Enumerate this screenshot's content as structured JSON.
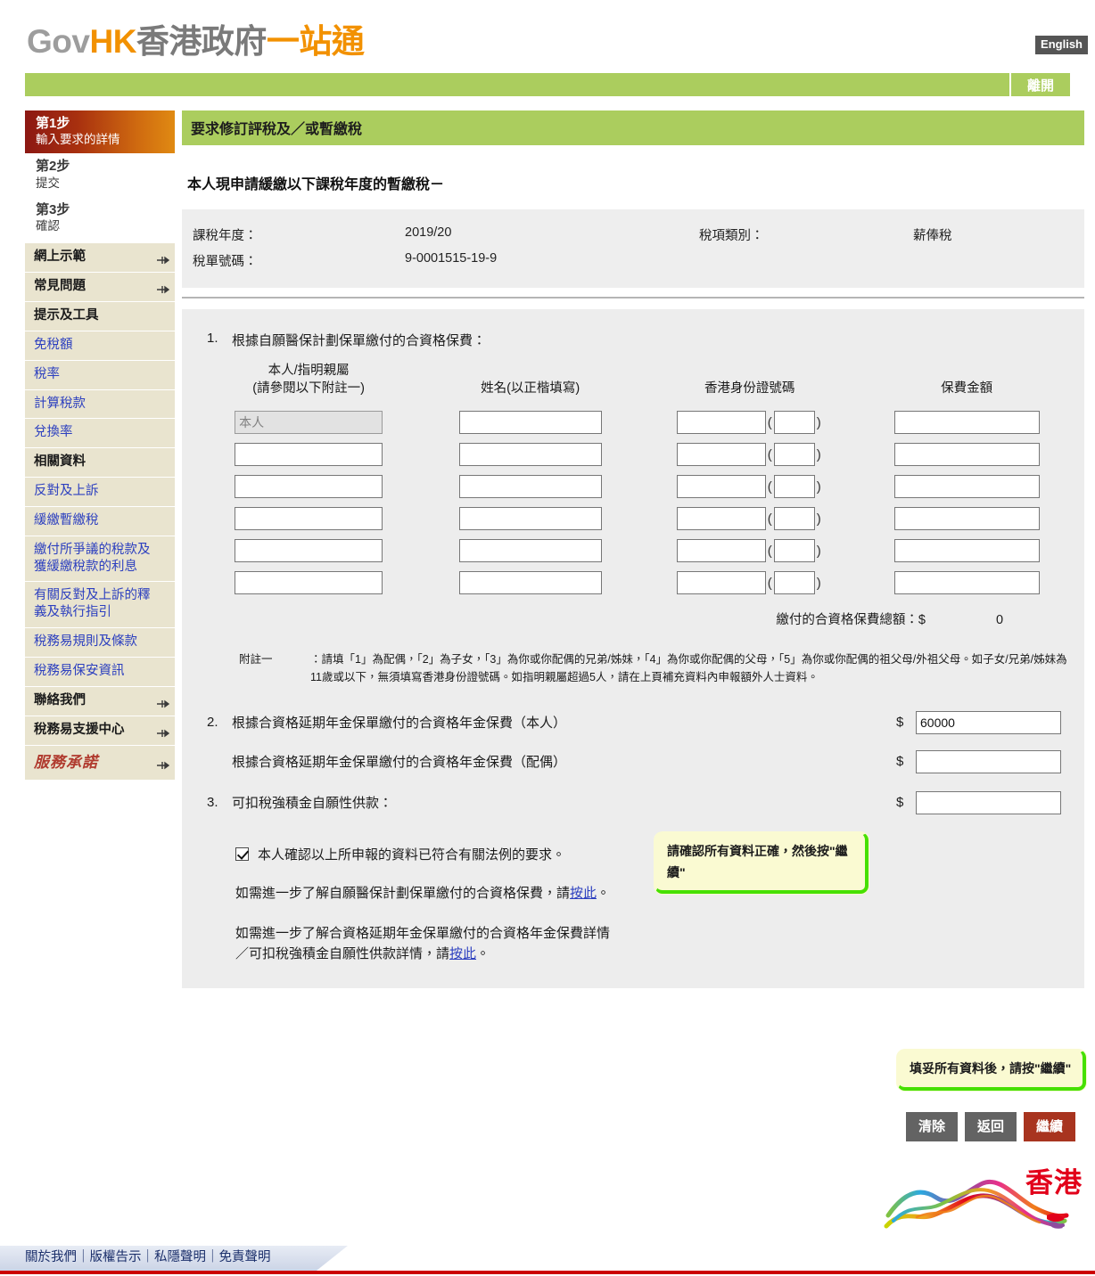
{
  "header": {
    "logo": {
      "gov": "Gov",
      "hk": "HK",
      "cn_gray": "香港政府",
      "cn_orange": "一站通"
    },
    "language_button": "English",
    "exit_button": "離開"
  },
  "sidebar": {
    "steps": [
      {
        "title": "第1步",
        "sub": "輸入要求的詳情",
        "active": true
      },
      {
        "title": "第2步",
        "sub": "提交",
        "active": false
      },
      {
        "title": "第3步",
        "sub": "確認",
        "active": false
      }
    ],
    "items": [
      {
        "label": "網上示範",
        "type": "head",
        "arrow": true
      },
      {
        "label": "常見問題",
        "type": "head",
        "arrow": true
      },
      {
        "label": "提示及工具",
        "type": "head",
        "arrow": false
      },
      {
        "label": "免稅額",
        "type": "link",
        "arrow": false
      },
      {
        "label": "稅率",
        "type": "link",
        "arrow": false
      },
      {
        "label": "計算稅款",
        "type": "link",
        "arrow": false
      },
      {
        "label": "兌換率",
        "type": "link",
        "arrow": false
      },
      {
        "label": "相關資料",
        "type": "head",
        "arrow": false
      },
      {
        "label": "反對及上訴",
        "type": "link",
        "arrow": false
      },
      {
        "label": "緩繳暫繳稅",
        "type": "link",
        "arrow": false
      },
      {
        "label": "繳付所爭議的稅款及獲緩繳稅款的利息",
        "type": "link",
        "arrow": false
      },
      {
        "label": "有關反對及上訴的釋義及執行指引",
        "type": "link",
        "arrow": false
      },
      {
        "label": "稅務易規則及條款",
        "type": "link",
        "arrow": false
      },
      {
        "label": "稅務易保安資訊",
        "type": "link",
        "arrow": false
      },
      {
        "label": "聯絡我們",
        "type": "head",
        "arrow": true
      },
      {
        "label": "稅務易支援中心",
        "type": "head",
        "arrow": true
      },
      {
        "label": "服務承諾",
        "type": "pledge",
        "arrow": true
      }
    ]
  },
  "main": {
    "page_title": "要求修訂評稅及／或暫繳稅",
    "section_heading": "本人現申請緩繳以下課稅年度的暫繳稅－",
    "info": {
      "year_label": "課稅年度：",
      "year_value": "2019/20",
      "type_label": "稅項類別：",
      "type_value": "薪俸稅",
      "bill_label": "稅單號碼：",
      "bill_value": "9-0001515-19-9"
    },
    "q1": {
      "number": "1.",
      "text": "根據自願醫保計劃保單繳付的合資格保費：",
      "columns": [
        {
          "line1": "本人/指明親屬",
          "line2": "(請參閱以下附註一)"
        },
        {
          "line1": "姓名(以正楷填寫)",
          "line2": ""
        },
        {
          "line1": "香港身份證號碼",
          "line2": ""
        },
        {
          "line1": "保費金額",
          "line2": ""
        }
      ],
      "rows": [
        {
          "relationship": "本人",
          "disabled": true,
          "name": "",
          "hkid": "",
          "hkid_check": "",
          "amount": ""
        },
        {
          "relationship": "",
          "disabled": false,
          "name": "",
          "hkid": "",
          "hkid_check": "",
          "amount": ""
        },
        {
          "relationship": "",
          "disabled": false,
          "name": "",
          "hkid": "",
          "hkid_check": "",
          "amount": ""
        },
        {
          "relationship": "",
          "disabled": false,
          "name": "",
          "hkid": "",
          "hkid_check": "",
          "amount": ""
        },
        {
          "relationship": "",
          "disabled": false,
          "name": "",
          "hkid": "",
          "hkid_check": "",
          "amount": ""
        },
        {
          "relationship": "",
          "disabled": false,
          "name": "",
          "hkid": "",
          "hkid_check": "",
          "amount": ""
        }
      ],
      "total_label": "繳付的合資格保費總額：$",
      "total_value": "0",
      "footnote_label": "附註一",
      "footnote_text": "：請填「1」為配偶，「2」為子女，「3」為你或你配偶的兄弟/姊妹，「4」為你或你配偶的父母，「5」為你或你配偶的祖父母/外祖父母。如子女/兄弟/姊妹為11歲或以下，無須填寫香港身份證號碼。如指明親屬超過5人，請在上頁補充資料內申報額外人士資料。"
    },
    "q2": {
      "number": "2.",
      "self_label": "根據合資格延期年金保單繳付的合資格年金保費（本人）",
      "self_value": "60000",
      "spouse_label": "根據合資格延期年金保單繳付的合資格年金保費（配偶）",
      "spouse_value": "",
      "dollar": "$"
    },
    "q3": {
      "number": "3.",
      "label": "可扣稅強積金自願性供款：",
      "value": "",
      "dollar": "$"
    },
    "confirm": {
      "checked": true,
      "label": "本人確認以上所申報的資料已符合有關法例的要求。"
    },
    "help_line1_before": "如需進一步了解自願醫保計劃保單繳付的合資格保費，請",
    "help_line1_link": "按此",
    "help_line1_after": "。",
    "help_line2a": "如需進一步了解合資格延期年金保單繳付的合資格年金保費詳情",
    "help_line2b_before": "／可扣稅強積金自願性供款詳情，請",
    "help_line2b_link": "按此",
    "help_line2b_after": "。",
    "callout_confirm": "請確認所有資料正確，然後按\"繼續\"",
    "callout_continue": "填妥所有資料後，請按\"繼續\"",
    "buttons": {
      "clear": "清除",
      "back": "返回",
      "continue": "繼續"
    }
  },
  "footer": {
    "brand_hk": "香港",
    "links": [
      "關於我們",
      "版權告示",
      "私隱聲明",
      "免責聲明"
    ],
    "separator": "｜"
  },
  "colors": {
    "green_bar": "#abcd5e",
    "orange_accent": "#f29100",
    "step_active_start": "#8c1813",
    "step_active_end": "#e08a12",
    "sidebar_beige": "#e9e4cf",
    "link_blue": "#2c3fbf",
    "button_red": "#a8341f",
    "button_gray": "#636363",
    "callout_yellow": "#fafad2",
    "callout_green": "#46e000",
    "footer_red": "#cc0000"
  }
}
